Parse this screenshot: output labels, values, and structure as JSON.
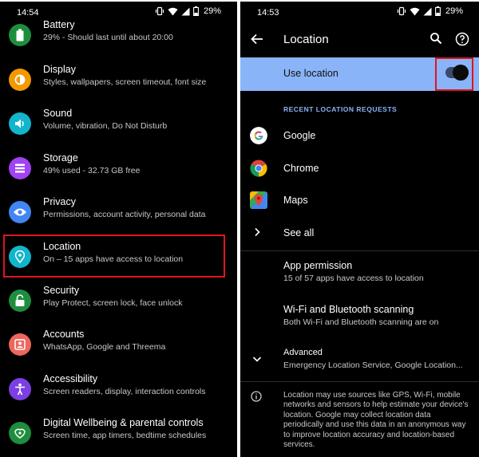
{
  "left": {
    "status": {
      "time": "14:54",
      "battery": "29%"
    },
    "settings": [
      {
        "title": "Battery",
        "sub": "29% - Should last until about 20:00",
        "icon": "battery-icon",
        "color": "#1e8e3e"
      },
      {
        "title": "Display",
        "sub": "Styles, wallpapers, screen timeout, font size",
        "icon": "display-icon",
        "color": "#f29900"
      },
      {
        "title": "Sound",
        "sub": "Volume, vibration, Do Not Disturb",
        "icon": "sound-icon",
        "color": "#12b5cb"
      },
      {
        "title": "Storage",
        "sub": "49% used - 32.73 GB free",
        "icon": "storage-icon",
        "color": "#a142f4"
      },
      {
        "title": "Privacy",
        "sub": "Permissions, account activity, personal data",
        "icon": "privacy-icon",
        "color": "#4285f4"
      },
      {
        "title": "Location",
        "sub": "On – 15 apps have access to location",
        "icon": "location-icon",
        "color": "#12b5cb"
      },
      {
        "title": "Security",
        "sub": "Play Protect, screen lock, face unlock",
        "icon": "security-icon",
        "color": "#1e8e3e"
      },
      {
        "title": "Accounts",
        "sub": "WhatsApp, Google and Threema",
        "icon": "accounts-icon",
        "color": "#ee675c"
      },
      {
        "title": "Accessibility",
        "sub": "Screen readers, display, interaction controls",
        "icon": "accessibility-icon",
        "color": "#7b3fe4"
      },
      {
        "title": "Digital Wellbeing & parental controls",
        "sub": "Screen time, app timers, bedtime schedules",
        "icon": "wellbeing-icon",
        "color": "#1e8e3e"
      }
    ]
  },
  "right": {
    "status": {
      "time": "14:53",
      "battery": "29%"
    },
    "appbar_title": "Location",
    "use_location": {
      "label": "Use location",
      "enabled": true
    },
    "recent_header": "RECENT LOCATION REQUESTS",
    "recent_apps": [
      {
        "name": "Google",
        "icon": "google-icon"
      },
      {
        "name": "Chrome",
        "icon": "chrome-icon"
      },
      {
        "name": "Maps",
        "icon": "maps-icon"
      }
    ],
    "see_all": "See all",
    "app_permission": {
      "title": "App permission",
      "sub": "15 of 57 apps have access to location"
    },
    "scanning": {
      "title": "Wi-Fi and Bluetooth scanning",
      "sub": "Both Wi-Fi and Bluetooth scanning are on"
    },
    "advanced": {
      "title": "Advanced",
      "sub": "Emergency Location Service, Google Location..."
    },
    "footer": "Location may use sources like GPS, Wi-Fi, mobile networks and sensors to help estimate your device's location. Google may collect location data periodically and use this data in an anonymous way to improve location accuracy and location-based services."
  },
  "colors": {
    "highlight": "#e0141e",
    "accent": "#8ab4f8"
  }
}
